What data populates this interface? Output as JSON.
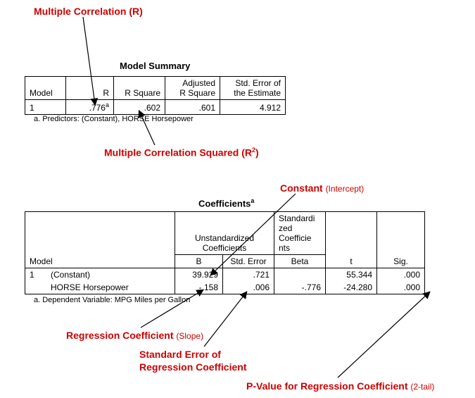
{
  "annotations": {
    "multR": "Multiple Correlation (R)",
    "multR2_a": "Multiple Correlation Squared (R",
    "multR2_b": ")",
    "constant_a": "Constant",
    "constant_b": "(Intercept)",
    "regCoef_a": "Regression Coefficient",
    "regCoef_b": "(Slope)",
    "stdErr_a": "Standard Error of",
    "stdErr_b": "Regression Coefficient",
    "pval_a": "P-Value for Regression Coefficient",
    "pval_b": "(2-tail)"
  },
  "summary": {
    "title": "Model Summary",
    "headers": {
      "model": "Model",
      "r": "R",
      "rsq": "R Square",
      "adjrsq_a": "Adjusted",
      "adjrsq_b": "R Square",
      "stderr_a": "Std. Error of",
      "stderr_b": "the Estimate"
    },
    "row": {
      "model": "1",
      "r": ".776",
      "r_sup": "a",
      "rsq": ".602",
      "adjrsq": ".601",
      "stderr": "4.912"
    },
    "footnote": "a. Predictors: (Constant), HORSE  Horsepower"
  },
  "coef": {
    "title": "Coefficients",
    "title_sup": "a",
    "headers": {
      "model": "Model",
      "unstd_a": "Unstandardized",
      "unstd_b": "Coefficients",
      "b": "B",
      "stderr": "Std. Error",
      "std_a": "Standardi",
      "std_b": "zed",
      "std_c": "Coefficie",
      "std_d": "nts",
      "beta": "Beta",
      "t": "t",
      "sig": "Sig."
    },
    "rows": [
      {
        "model": "1",
        "name": "(Constant)",
        "b": "39.929",
        "stderr": ".721",
        "beta": "",
        "t": "55.344",
        "sig": ".000"
      },
      {
        "model": "",
        "name": "HORSE  Horsepower",
        "b": "-.158",
        "stderr": ".006",
        "beta": "-.776",
        "t": "-24.280",
        "sig": ".000"
      }
    ],
    "footnote": "a. Dependent Variable: MPG  Miles per Gallon"
  }
}
